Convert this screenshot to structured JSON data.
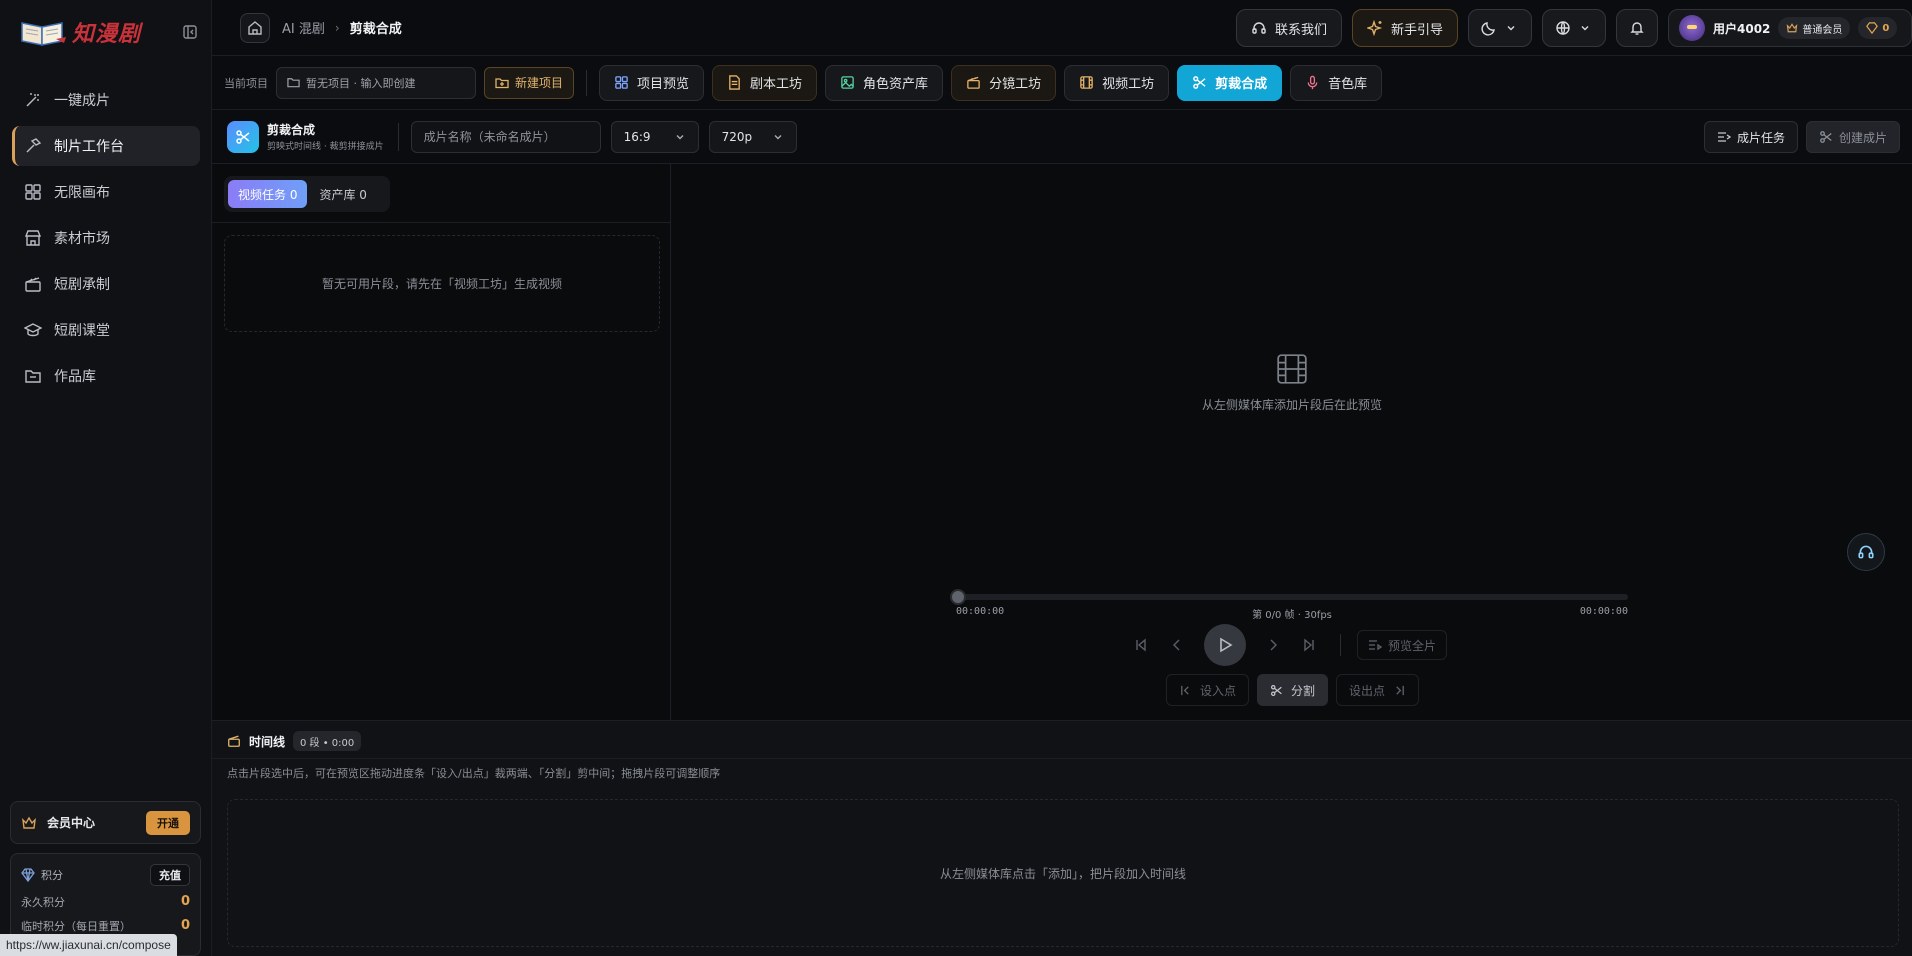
{
  "app": {
    "logo_text": "知漫剧",
    "url": "https://ww.jiaxunai.cn/compose"
  },
  "sidebar": {
    "items": [
      {
        "label": "一键成片",
        "icon": "magic-wand-icon"
      },
      {
        "label": "制片工作台",
        "icon": "hammer-icon",
        "active": true
      },
      {
        "label": "无限画布",
        "icon": "grid-icon"
      },
      {
        "label": "素材市场",
        "icon": "store-icon"
      },
      {
        "label": "短剧承制",
        "icon": "clapperboard-icon"
      },
      {
        "label": "短剧课堂",
        "icon": "graduation-cap-icon"
      },
      {
        "label": "作品库",
        "icon": "folder-icon"
      }
    ],
    "member": {
      "label": "会员中心",
      "button": "开通"
    },
    "points": {
      "label": "积分",
      "recharge": "充值",
      "rows": [
        {
          "label": "永久积分",
          "value": "0"
        },
        {
          "label": "临时积分（每日重置）",
          "value": "0"
        }
      ]
    }
  },
  "topbar": {
    "breadcrumb": {
      "root": "AI 混剧",
      "sep": "›",
      "current": "剪裁合成"
    },
    "contact": "联系我们",
    "guide": "新手引导",
    "user": {
      "name": "用户4002",
      "tier": "普通会员",
      "points": "0"
    }
  },
  "project": {
    "label": "当前项目",
    "select_text": "暂无项目 · 输入即创建",
    "new_button": "新建项目",
    "tabs": [
      {
        "label": "项目预览",
        "icon": "layout-grid-icon",
        "tone": "blue"
      },
      {
        "label": "剧本工坊",
        "icon": "document-icon",
        "tone": "amber"
      },
      {
        "label": "角色资产库",
        "icon": "image-icon",
        "tone": "green"
      },
      {
        "label": "分镜工坊",
        "icon": "clapper-icon",
        "tone": "gold"
      },
      {
        "label": "视频工坊",
        "icon": "film-icon",
        "tone": "amber"
      },
      {
        "label": "剪裁合成",
        "icon": "scissors-icon",
        "tone": "active"
      },
      {
        "label": "音色库",
        "icon": "microphone-icon",
        "tone": "pink"
      }
    ]
  },
  "editor": {
    "title": "剪裁合成",
    "subtitle": "剪映式时间线 · 裁剪拼接成片",
    "name_placeholder": "成片名称（未命名成片）",
    "ratio": "16:9",
    "resolution": "720p",
    "tasks_button": "成片任务",
    "create_button": "创建成片"
  },
  "media": {
    "tabs": [
      {
        "label": "视频任务 0",
        "active": true
      },
      {
        "label": "资产库 0",
        "active": false
      }
    ],
    "empty": "暂无可用片段，请先在「视频工坊」生成视频"
  },
  "preview": {
    "empty": "从左侧媒体库添加片段后在此预览",
    "time_start": "00:00:00",
    "frame_info": "第 0/0 帧 · 30fps",
    "time_end": "00:00:00",
    "preview_all": "预览全片",
    "set_in": "设入点",
    "split": "分割",
    "set_out": "设出点"
  },
  "timeline": {
    "title": "时间线",
    "badge": "0 段 • 0:00",
    "hint": "点击片段选中后，可在预览区拖动进度条「设入/出点」裁两端、「分割」剪中间；拖拽片段可调整顺序",
    "empty": "从左侧媒体库点击「添加」，把片段加入时间线"
  }
}
